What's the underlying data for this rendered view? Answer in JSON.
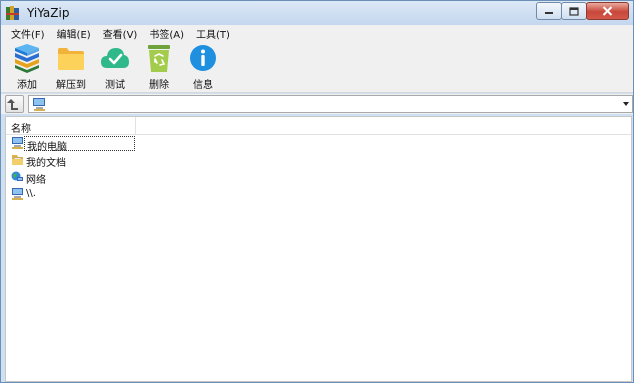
{
  "window": {
    "title": "YiYaZip"
  },
  "menu": [
    {
      "label": "文件(F)"
    },
    {
      "label": "编辑(E)"
    },
    {
      "label": "查看(V)"
    },
    {
      "label": "书签(A)"
    },
    {
      "label": "工具(T)"
    }
  ],
  "toolbar": [
    {
      "label": "添加",
      "icon": "add-books-icon"
    },
    {
      "label": "解压到",
      "icon": "folder-icon"
    },
    {
      "label": "测试",
      "icon": "cloud-check-icon"
    },
    {
      "label": "删除",
      "icon": "recycle-bin-icon"
    },
    {
      "label": "信息",
      "icon": "info-icon"
    }
  ],
  "address": {
    "value": ""
  },
  "list": {
    "column_name": "名称",
    "rows": [
      {
        "name": "我的电脑",
        "icon": "computer-icon"
      },
      {
        "name": "我的文档",
        "icon": "documents-icon"
      },
      {
        "name": "网络",
        "icon": "network-icon"
      },
      {
        "name": "\\\\.",
        "icon": "computer-icon"
      }
    ]
  }
}
